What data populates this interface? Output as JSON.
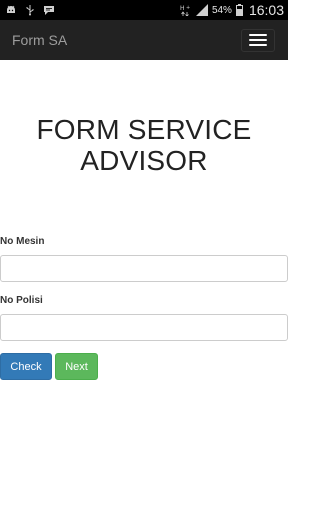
{
  "statusbar": {
    "battery_percent": "54%",
    "time": "16:03",
    "icons": [
      "android-icon",
      "usb-icon",
      "chat-icon",
      "data-transfer-icon",
      "signal-icon",
      "battery-icon"
    ]
  },
  "navbar": {
    "brand": "Form SA",
    "toggle_icon": "hamburger-menu-icon"
  },
  "page": {
    "title_line1": "FORM SERVICE",
    "title_line2": "ADVISOR"
  },
  "form": {
    "no_mesin_label": "No Mesin",
    "no_mesin_value": "",
    "no_polisi_label": "No Polisi",
    "no_polisi_value": "",
    "check_label": "Check",
    "next_label": "Next"
  },
  "colors": {
    "navbar_bg": "#222222",
    "primary": "#337ab7",
    "success": "#5cb85c"
  }
}
